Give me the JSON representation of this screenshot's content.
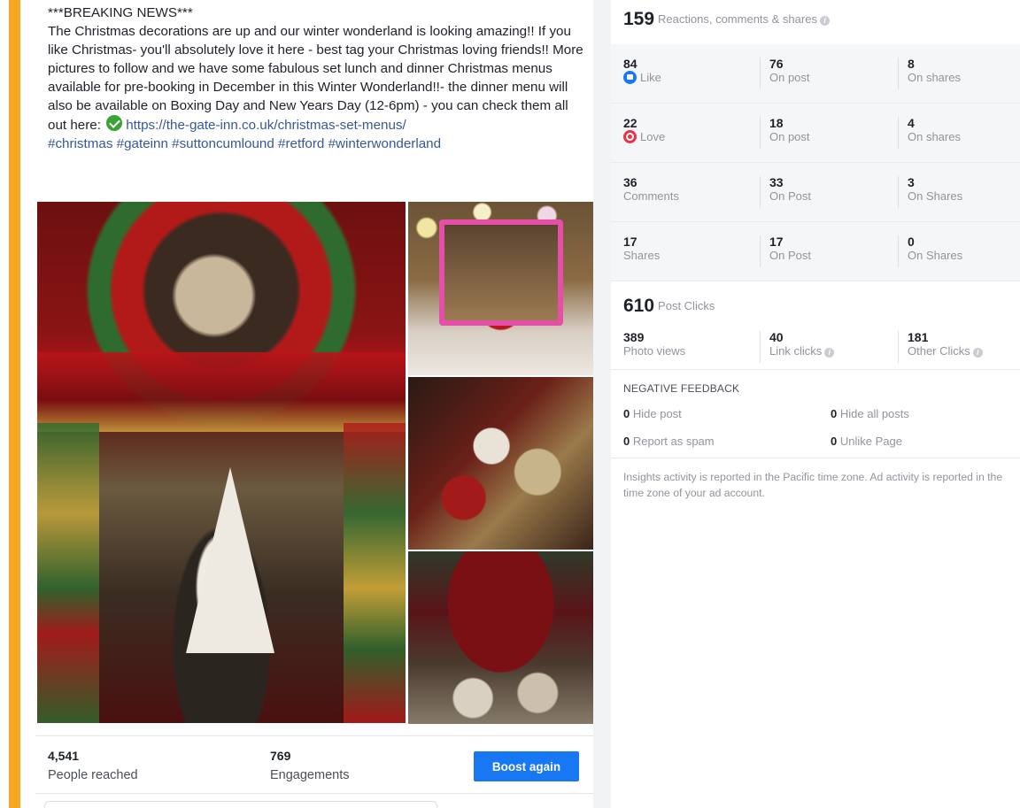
{
  "post": {
    "header": "***BREAKING NEWS***",
    "body": "The Christmas decorations are up and our winter wonderland is looking amazing!! If you like Christmas- you'll absolutely love it here - best tag your Christmas loving friends!! More pictures to follow and we have some fabulous set lunch and dinner Christmas menus available for pre-booking in December in this Winter Wonderland!!- the dinner menu will also be available on Boxing Day and New Years Day (12-6pm) - you can check them all out here:",
    "link": "https://the-gate-inn.co.uk/christmas-set-menus/",
    "hashtags": "#christmas #gateinn #suttoncumlound #retford #winterwonderland",
    "people_reached_value": "4,541",
    "people_reached_label": "People reached",
    "engagements_value": "769",
    "engagements_label": "Engagements",
    "boost_label": "Boost again",
    "accent_color": "#f5a623"
  },
  "insights": {
    "total": "159",
    "total_label": "Reactions, comments & shares",
    "rows": [
      {
        "a_value": "84",
        "a_label": "Like",
        "b_value": "76",
        "b_label": "On post",
        "c_value": "8",
        "c_label": "On shares"
      },
      {
        "a_value": "22",
        "a_label": "Love",
        "b_value": "18",
        "b_label": "On post",
        "c_value": "4",
        "c_label": "On shares"
      },
      {
        "a_value": "36",
        "a_label": "Comments",
        "b_value": "33",
        "b_label": "On Post",
        "c_value": "3",
        "c_label": "On Shares"
      },
      {
        "a_value": "17",
        "a_label": "Shares",
        "b_value": "17",
        "b_label": "On Post",
        "c_value": "0",
        "c_label": "On Shares"
      }
    ],
    "post_clicks": "610",
    "post_clicks_label": "Post Clicks",
    "clicks": [
      {
        "value": "389",
        "label": "Photo views"
      },
      {
        "value": "40",
        "label": "Link clicks"
      },
      {
        "value": "181",
        "label": "Other Clicks"
      }
    ],
    "negative_title": "NEGATIVE FEEDBACK",
    "negative": [
      {
        "value": "0",
        "label": "Hide post"
      },
      {
        "value": "0",
        "label": "Hide all posts"
      },
      {
        "value": "0",
        "label": "Report as spam"
      },
      {
        "value": "0",
        "label": "Unlike Page"
      }
    ],
    "note": "Insights activity is reported in the Pacific time zone. Ad activity is reported in the time zone of your ad account.",
    "like_color": "#1877f2",
    "love_color": "#e8334a"
  }
}
